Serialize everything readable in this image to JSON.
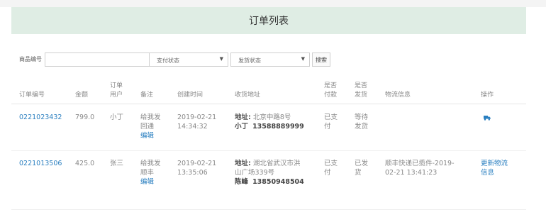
{
  "header": {
    "title": "订单列表"
  },
  "filters": {
    "code_label": "商品编号",
    "code_value": "",
    "pay_status": "支付状态",
    "ship_status": "发货状态",
    "search_label": "搜索"
  },
  "table": {
    "columns": {
      "order_no": "订单编号",
      "amount": "金额",
      "user_l1": "订单",
      "user_l2": "用户",
      "note": "备注",
      "created": "创建时间",
      "address": "收货地址",
      "paid_l1": "是否",
      "paid_l2": "付款",
      "shipped_l1": "是否",
      "shipped_l2": "发货",
      "logistics": "物流信息",
      "actions": "操作"
    },
    "rows": [
      {
        "order_no": "0221023432",
        "amount": "799.0",
        "user": "小丁",
        "note_l1": "给我发",
        "note_l2": "回通",
        "edit": "编辑",
        "date": "2019-02-21",
        "time": "14:34:32",
        "addr_label": "地址:",
        "addr_l1": "北京中路8号",
        "name": "小丁",
        "phone": "13588889999",
        "paid_l1": "已支",
        "paid_l2": "付",
        "shipped_l1": "等待",
        "shipped_l2": "发货",
        "logistics_l1": "",
        "logistics_l2": "",
        "action_icon": "truck-icon"
      },
      {
        "order_no": "0221013506",
        "amount": "425.0",
        "user": "张三",
        "note_l1": "给我发",
        "note_l2": "顺丰",
        "edit": "编辑",
        "date": "2019-02-21",
        "time": "13:35:06",
        "addr_label": "地址:",
        "addr_l1": "湖北省武汉市洪",
        "addr_l2": "山广场339号",
        "name": "陈峰",
        "phone": "13850948504",
        "paid_l1": "已支",
        "paid_l2": "付",
        "shipped_l1": "已发",
        "shipped_l2": "货",
        "logistics_l1": "顺丰快递已揽件-2019-",
        "logistics_l2": "02-21 13:41:23",
        "action_l1": "更新物流",
        "action_l2": "信息"
      }
    ]
  },
  "colors": {
    "header_bg": "#dfede4",
    "link": "#2a7fc0"
  }
}
